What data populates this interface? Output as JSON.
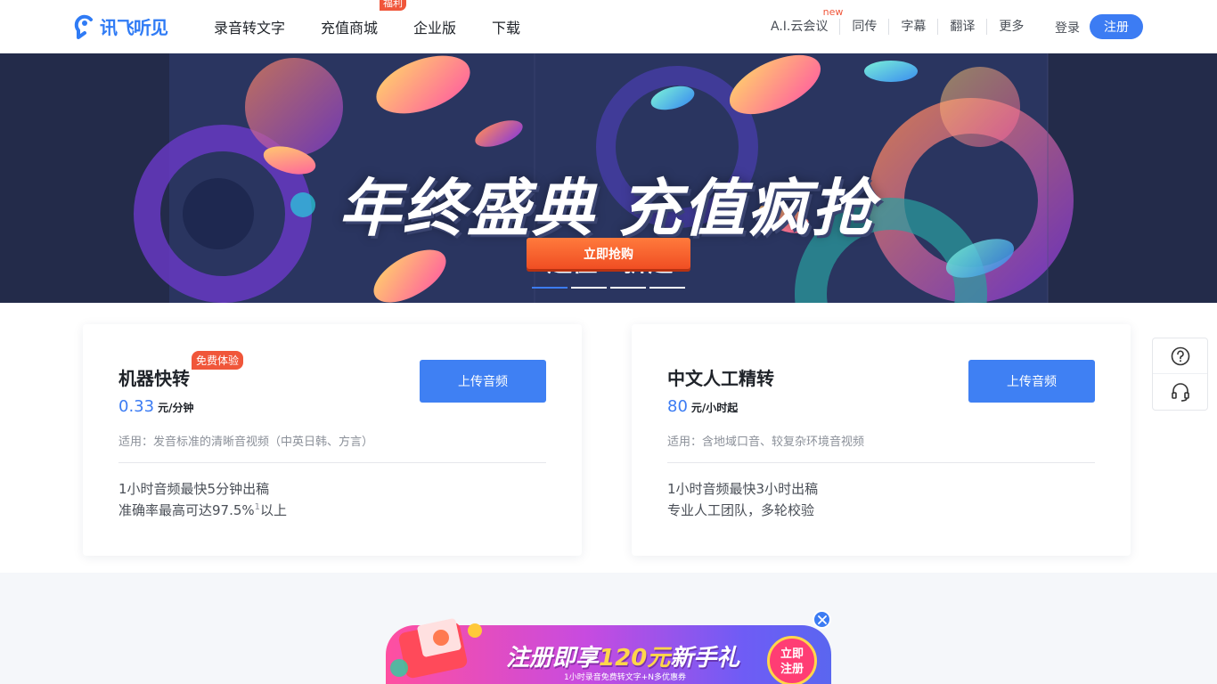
{
  "header": {
    "logo_text": "讯飞听见",
    "nav": [
      {
        "label": "录音转文字"
      },
      {
        "label": "充值商城",
        "badge": "福利"
      },
      {
        "label": "企业版"
      },
      {
        "label": "下载"
      }
    ],
    "right_nav": [
      {
        "label": "A.I.云会议",
        "tag": "new"
      },
      {
        "label": "同传"
      },
      {
        "label": "字幕"
      },
      {
        "label": "翻译"
      },
      {
        "label": "更多"
      }
    ],
    "login": "登录",
    "register": "注册"
  },
  "banner": {
    "title": "年终盛典 充值疯抢",
    "sub_prefix": "超值",
    "sub_number": "3",
    "sub_suffix": "折起",
    "cta": "立即抢购",
    "active_slide": 1,
    "slide_count": 4
  },
  "cards": [
    {
      "title": "机器快转",
      "badge": "免费体验",
      "price": "0.33",
      "unit": "元/分钟",
      "apply": "适用：发音标准的清晰音视频（中英日韩、方言）",
      "feature1": "1小时音频最快5分钟出稿",
      "feature2": "准确率最高可达97.5%",
      "feature2_sup": "1",
      "feature2_tail": "以上",
      "button": "上传音频"
    },
    {
      "title": "中文人工精转",
      "price": "80",
      "unit": "元/小时起",
      "apply": "适用：含地域口音、较复杂环境音视频",
      "feature1": "1小时音频最快3小时出稿",
      "feature2": "专业人工团队，多轮校验",
      "button": "上传音频"
    }
  ],
  "promo": {
    "text_prefix": "注册即享",
    "text_highlight": "120元",
    "text_suffix": "新手礼",
    "small": "1小时录音免费转文字+N多优惠券",
    "cta_line1": "立即",
    "cta_line2": "注册"
  },
  "colors": {
    "accent": "#3c7cf3",
    "badge": "#f0563a",
    "banner_bg": "#232b4a"
  },
  "icons": [
    "logo-ear-icon",
    "question-icon",
    "headset-icon",
    "close-icon"
  ]
}
